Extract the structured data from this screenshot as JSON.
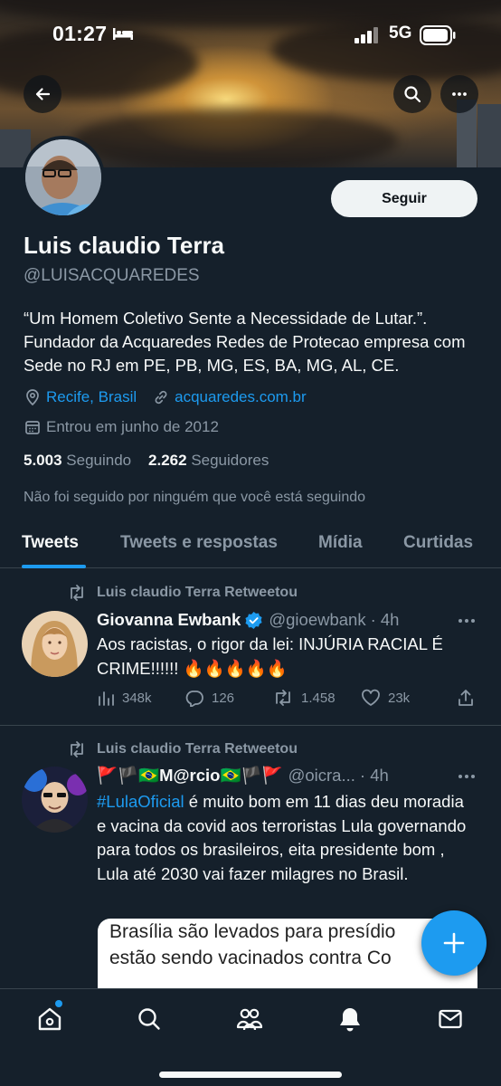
{
  "status_bar": {
    "time": "01:27",
    "network": "5G"
  },
  "profile": {
    "follow_label": "Seguir",
    "name": "Luis claudio Terra",
    "handle": "@LUISACQUAREDES",
    "bio": "“Um Homem Coletivo Sente a Necessidade de Lutar.”. Fundador da Acquaredes Redes de Protecao empresa com Sede no RJ em PE, PB, MG, ES, BA, MG, AL, CE.",
    "location": "Recife, Brasil",
    "website": "acquaredes.com.br",
    "joined": "Entrou em junho de 2012",
    "following_count": "5.003",
    "following_label": "Seguindo",
    "followers_count": "2.262",
    "followers_label": "Seguidores",
    "not_followed_note": "Não foi seguido por ninguém que você está seguindo"
  },
  "tabs": [
    "Tweets",
    "Tweets e respostas",
    "Mídia",
    "Curtidas"
  ],
  "tweets": [
    {
      "retweet_label": "Luis claudio Terra Retweetou",
      "author_name": "Giovanna Ewbank",
      "verified": true,
      "author_handle": "@gioewbank",
      "age": "· 4h",
      "text": "Aos racistas, o rigor da lei: INJÚRIA RACIAL É CRIME!!!!!! 🔥🔥🔥🔥🔥",
      "views": "348k",
      "replies": "126",
      "retweets": "1.458",
      "likes": "23k"
    },
    {
      "retweet_label": "Luis claudio Terra Retweetou",
      "author_name": "🚩🏴🇧🇷M@rcio🇧🇷🏴🚩",
      "author_handle": "@oicra...",
      "age": "· 4h",
      "hashtag": "#LulaOficial",
      "text": " é muito bom em 11 dias deu moradia e vacina da covid aos terroristas Lula governando para todos os brasileiros, eita presidente bom , Lula até 2030 vai fazer milagres no Brasil.",
      "card_lines": [
        "Brasília são levados para presídio",
        "estão sendo vacinados contra Co"
      ]
    }
  ],
  "colors": {
    "accent": "#1d9bf0",
    "background": "#15202b",
    "secondary_text": "#8b98a5"
  },
  "icons": [
    "back-arrow-icon",
    "search-icon",
    "more-icon",
    "location-icon",
    "link-icon",
    "calendar-icon",
    "retweet-icon",
    "verified-icon",
    "views-icon",
    "reply-icon",
    "like-icon",
    "share-icon",
    "compose-icon",
    "home-icon",
    "communities-icon",
    "bell-icon",
    "mail-icon"
  ]
}
